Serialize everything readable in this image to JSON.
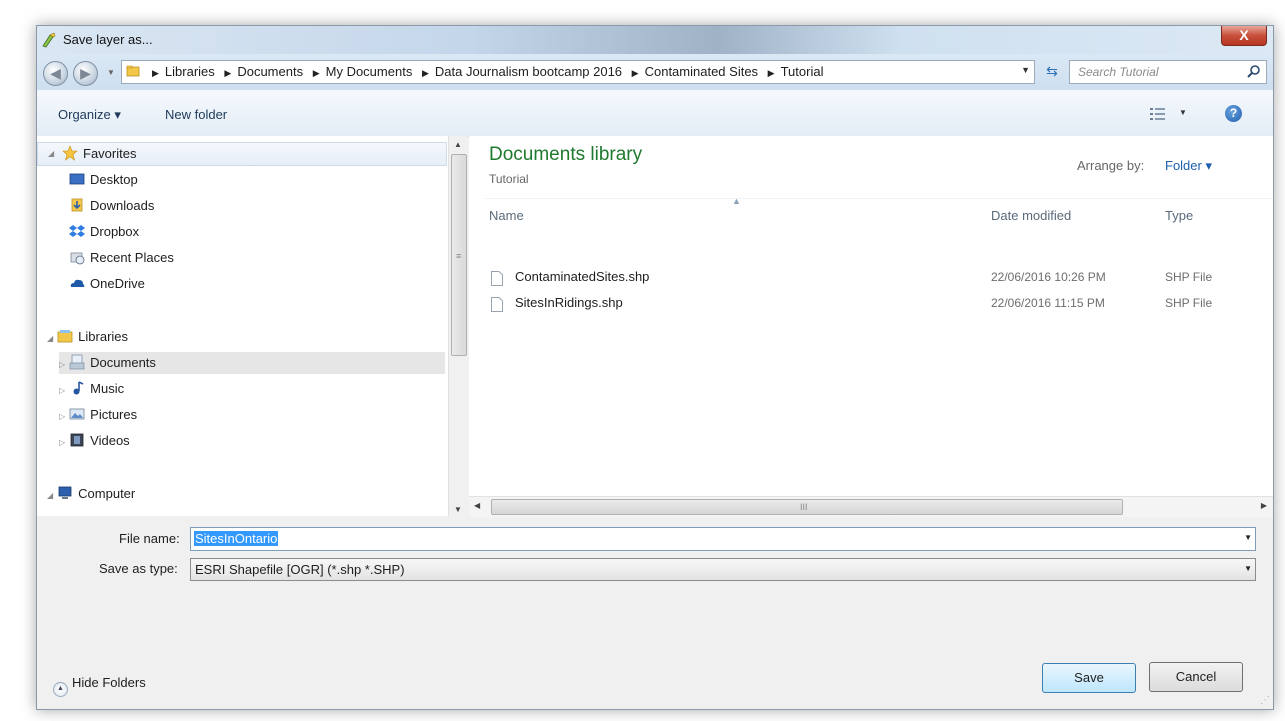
{
  "window": {
    "title": "Save layer as...",
    "close_label": "X"
  },
  "address_bar": {
    "crumbs": [
      "Libraries",
      "Documents",
      "My Documents",
      "Data Journalism bootcamp 2016",
      "Contaminated Sites",
      "Tutorial"
    ],
    "search_placeholder": "Search Tutorial"
  },
  "toolbar": {
    "organize_label": "Organize ▾",
    "new_folder_label": "New folder"
  },
  "nav_pane": {
    "favorites_header": "Favorites",
    "favorites": [
      "Desktop",
      "Downloads",
      "Dropbox",
      "Recent Places",
      "OneDrive"
    ],
    "libraries_header": "Libraries",
    "libraries": [
      "Documents",
      "Music",
      "Pictures",
      "Videos"
    ],
    "selected": "Documents",
    "computer_header": "Computer"
  },
  "content": {
    "library_title": "Documents library",
    "library_subtitle": "Tutorial",
    "arrange_by_label": "Arrange by:",
    "arrange_by_value": "Folder ▾",
    "columns": {
      "name": "Name",
      "date": "Date modified",
      "type": "Type"
    },
    "files": [
      {
        "name": "ContaminatedSites.shp",
        "date": "22/06/2016 10:26 PM",
        "type": "SHP File"
      },
      {
        "name": "SitesInRidings.shp",
        "date": "22/06/2016 11:15 PM",
        "type": "SHP File"
      }
    ]
  },
  "form": {
    "file_name_label": "File name:",
    "file_name_value": "SitesInOntario",
    "save_as_type_label": "Save as type:",
    "save_as_type_value": "ESRI Shapefile [OGR] (*.shp *.SHP)"
  },
  "footer": {
    "hide_folders_label": "Hide Folders",
    "save_label": "Save",
    "cancel_label": "Cancel"
  },
  "colors": {
    "library_title": "#1e7a2e",
    "link_blue": "#1f5fae",
    "selection": "#3399ff"
  },
  "icons": {
    "title": "qgis-icon",
    "back": "back-arrow-icon",
    "forward": "forward-arrow-icon",
    "refresh": "refresh-icon",
    "search": "search-icon",
    "views": "view-options-icon",
    "help": "help-icon"
  }
}
